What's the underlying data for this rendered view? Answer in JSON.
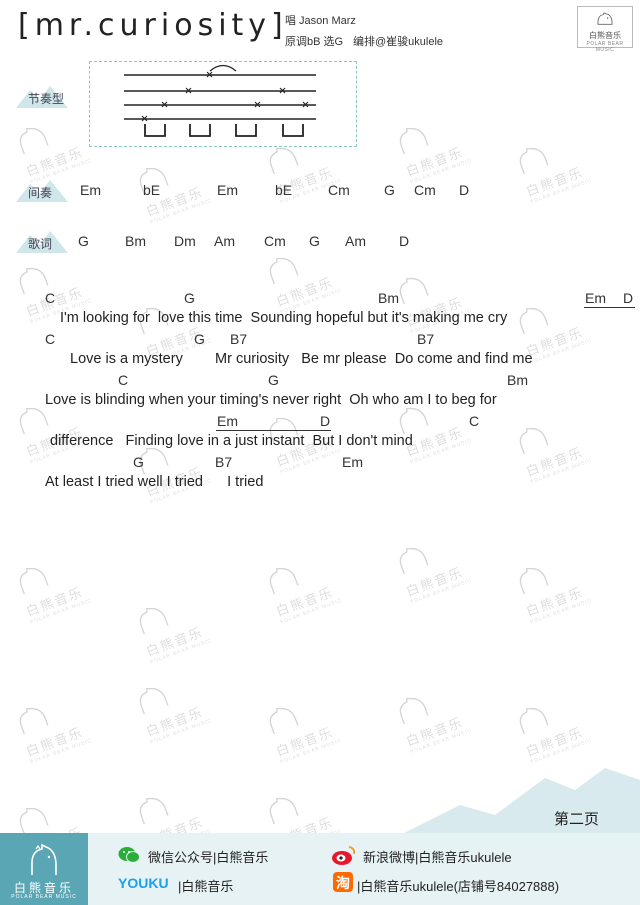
{
  "header": {
    "title": "[mr.curiosity]",
    "singer": "唱 Jason Marz",
    "key_info": "原调bB 选G",
    "arranger": "编排@崔骏ukulele",
    "logo_text": "白熊音乐",
    "logo_sub": "POLAR BEAR MUSIC"
  },
  "sections": {
    "rhythm_label": "节奏型",
    "intro_label": "间奏",
    "verse_label": "歌词"
  },
  "intro_chords": [
    "Em",
    "bE",
    "Em",
    "bE",
    "Cm",
    "G",
    "Cm",
    "D"
  ],
  "verse_chords": [
    "G",
    "Bm",
    "Dm",
    "Am",
    "Cm",
    "G",
    "Am",
    "D"
  ],
  "song": {
    "chords_1": [
      "C",
      "G",
      "Bm",
      "Em",
      "D"
    ],
    "lyric_1": "I'm looking for  love this time  Sounding hopeful but it's making me cry",
    "chords_2": [
      "C",
      "G",
      "B7",
      "B7"
    ],
    "lyric_2": "Love is a mystery        Mr curiosity   Be mr please  Do come and find me",
    "chords_3": [
      "C",
      "G",
      "Bm"
    ],
    "lyric_3": "Love is blinding when your timing's never right  Oh who am I to beg for",
    "chords_4": [
      "Em",
      "D",
      "C"
    ],
    "lyric_4": "difference   Finding love in a just instant  But I don't mind",
    "chords_5": [
      "G",
      "B7",
      "Em"
    ],
    "lyric_5": "At least I tried well I tried      I tried"
  },
  "footer": {
    "page": "第二页",
    "logo_name": "白熊音乐",
    "logo_sub": "POLAR BEAR MUSIC",
    "wechat": "微信公众号|白熊音乐",
    "weibo": "新浪微博|白熊音乐ukulele",
    "youku_brand": "YOUKU",
    "youku_text": "|白熊音乐",
    "taobao": "|白熊音乐ukulele(店铺号84027888)"
  },
  "watermark": {
    "text": "白熊音乐",
    "sub": "POLAR BEAR MUSIC"
  },
  "colors": {
    "accent": "#5aa6b4",
    "footer_bg": "#e6f2f4",
    "box_border": "#8cc7c7"
  },
  "icons": [
    "wechat-icon",
    "weibo-icon",
    "taobao-icon",
    "bear-logo-icon",
    "mountain-icon"
  ]
}
